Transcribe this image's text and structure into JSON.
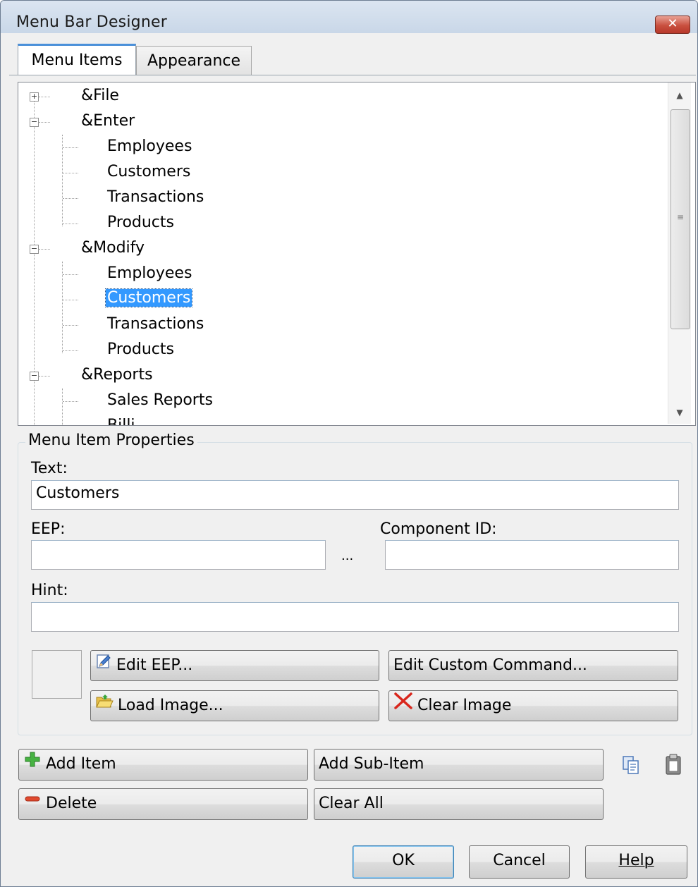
{
  "window": {
    "title": "Menu Bar Designer",
    "close_glyph": "✕"
  },
  "tabs": [
    {
      "label": "Menu Items",
      "active": true
    },
    {
      "label": "Appearance",
      "active": false
    }
  ],
  "tree": {
    "items": [
      {
        "label": "&File",
        "level": 0,
        "expander": "+"
      },
      {
        "label": "&Enter",
        "level": 0,
        "expander": "−"
      },
      {
        "label": "Employees",
        "level": 1
      },
      {
        "label": "Customers",
        "level": 1
      },
      {
        "label": "Transactions",
        "level": 1
      },
      {
        "label": "Products",
        "level": 1
      },
      {
        "label": "&Modify",
        "level": 0,
        "expander": "−"
      },
      {
        "label": "Employees",
        "level": 1
      },
      {
        "label": "Customers",
        "level": 1,
        "selected": true
      },
      {
        "label": "Transactions",
        "level": 1
      },
      {
        "label": "Products",
        "level": 1
      },
      {
        "label": "&Reports",
        "level": 0,
        "expander": "−"
      },
      {
        "label": "Sales Reports",
        "level": 1
      },
      {
        "label": "Billi",
        "level": 1
      }
    ],
    "selected_color": "#3399ff"
  },
  "properties": {
    "group_title": "Menu Item Properties",
    "text_label": "Text:",
    "text_value": "Customers",
    "eep_label": "EEP:",
    "eep_value": "",
    "ellipsis": "...",
    "component_label": "Component ID:",
    "component_value": "",
    "hint_label": "Hint:",
    "hint_value": ""
  },
  "buttons": {
    "edit_eep": "Edit EEP...",
    "edit_custom": "Edit Custom Command...",
    "load_image": "Load Image...",
    "clear_image": "Clear Image",
    "add_item": "Add Item",
    "add_sub_item": "Add Sub-Item",
    "delete": "Delete",
    "clear_all": "Clear All",
    "ok": "OK",
    "cancel": "Cancel",
    "help": "Help"
  },
  "icons": {
    "edit_eep": "pencil-icon",
    "load_image": "folder-icon",
    "clear_image": "red-x-icon",
    "add_item": "green-plus-icon",
    "delete": "red-minus-icon",
    "copy": "copy-icon",
    "paste": "paste-icon"
  },
  "colors": {
    "accent": "#4a90d9",
    "ok_border": "#3c7fb1"
  }
}
